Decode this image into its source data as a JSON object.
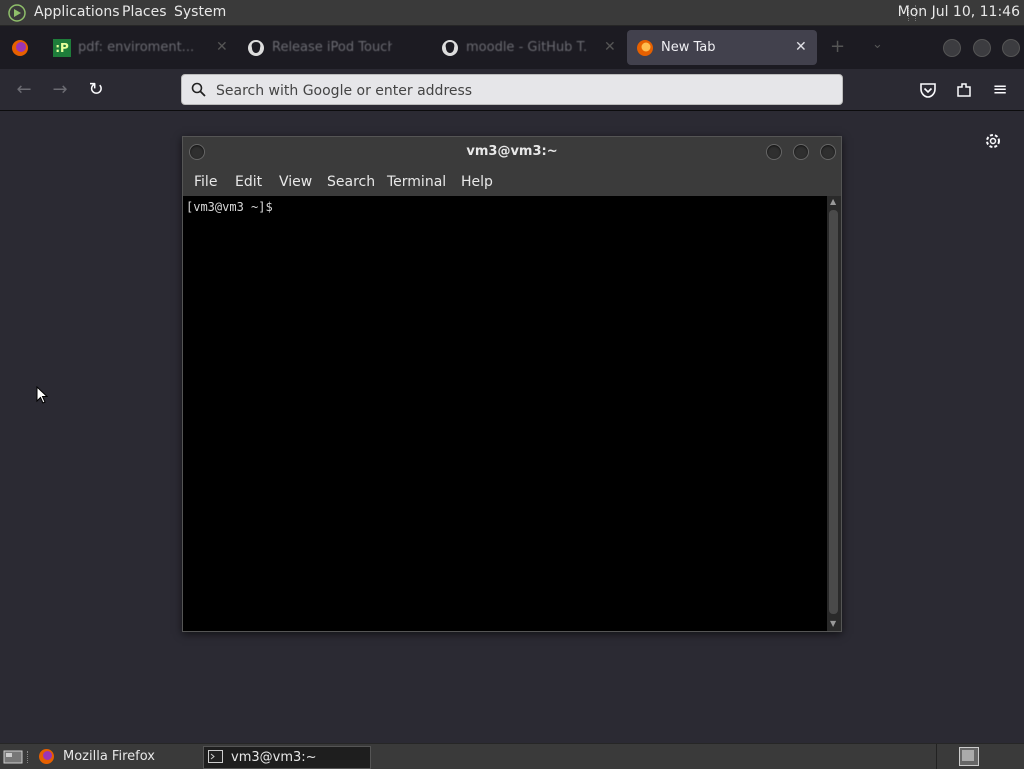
{
  "top_panel": {
    "menus": [
      "Applications",
      "Places",
      "System"
    ],
    "clock": "Mon Jul 10, 11:46"
  },
  "browser": {
    "tabs": [
      {
        "title": "pdf: enviroment...",
        "icon": "pdf-site-icon",
        "active": false
      },
      {
        "title": "Release iPod Touch",
        "icon": "github-icon",
        "active": false
      },
      {
        "title": "moodle - GitHub T...",
        "icon": "github-icon",
        "active": false
      },
      {
        "title": "New Tab",
        "icon": "firefox-icon",
        "active": true
      }
    ],
    "urlbar_placeholder": "Search with Google or enter address",
    "accent": "#42414d"
  },
  "terminal": {
    "title": "vm3@vm3:~",
    "menus": [
      "File",
      "Edit",
      "View",
      "Search",
      "Terminal",
      "Help"
    ],
    "prompt": "[vm3@vm3 ~]$"
  },
  "taskbar": {
    "items": [
      {
        "label": "Mozilla Firefox",
        "active": false
      },
      {
        "label": "vm3@vm3:~",
        "active": true
      }
    ]
  }
}
